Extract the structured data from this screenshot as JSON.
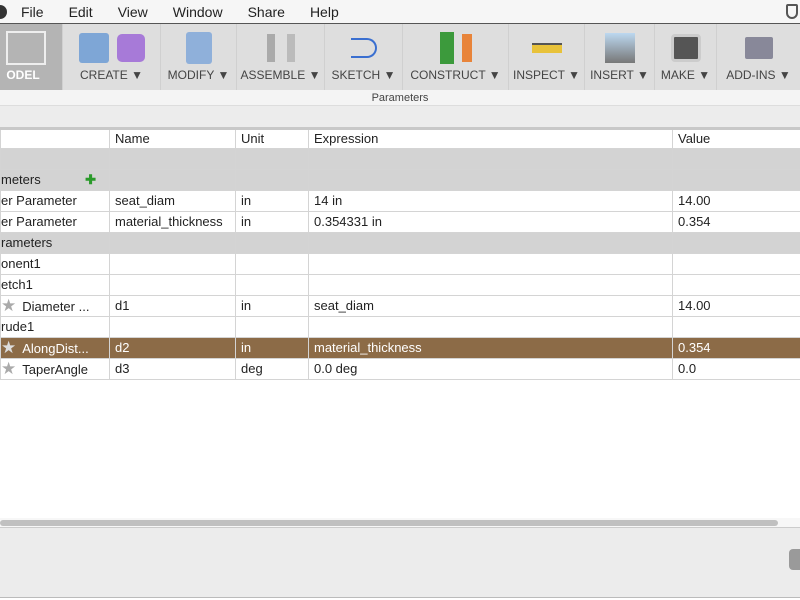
{
  "menu": [
    "File",
    "Edit",
    "View",
    "Window",
    "Share",
    "Help"
  ],
  "toolbar": {
    "groups": [
      "ODEL",
      "CREATE",
      "MODIFY",
      "ASSEMBLE",
      "SKETCH",
      "CONSTRUCT",
      "INSPECT",
      "INSERT",
      "MAKE",
      "ADD-INS"
    ]
  },
  "dialog_title": "Parameters",
  "table": {
    "headers": [
      "",
      "Name",
      "Unit",
      "Expression",
      "Value"
    ],
    "rows": [
      {
        "c0": "",
        "name": "",
        "unit": "",
        "expr": "",
        "value": ""
      },
      {
        "c0": "meters",
        "name": "",
        "unit": "",
        "expr": "",
        "value": ""
      },
      {
        "c0": "er Parameter",
        "name": "seat_diam",
        "unit": "in",
        "expr": "14 in",
        "value": "14.00"
      },
      {
        "c0": "er Parameter",
        "name": "material_thickness",
        "unit": "in",
        "expr": "0.354331 in",
        "value": "0.354"
      },
      {
        "c0": "rameters",
        "name": "",
        "unit": "",
        "expr": "",
        "value": ""
      },
      {
        "c0": "onent1",
        "name": "",
        "unit": "",
        "expr": "",
        "value": ""
      },
      {
        "c0": "etch1",
        "name": "",
        "unit": "",
        "expr": "",
        "value": ""
      },
      {
        "c0": "Diameter ...",
        "name": "d1",
        "unit": "in",
        "expr": "seat_diam",
        "value": "14.00"
      },
      {
        "c0": "rude1",
        "name": "",
        "unit": "",
        "expr": "",
        "value": ""
      },
      {
        "c0": "AlongDist...",
        "name": "d2",
        "unit": "in",
        "expr": "material_thickness",
        "value": "0.354"
      },
      {
        "c0": "TaperAngle",
        "name": "d3",
        "unit": "deg",
        "expr": "0.0 deg",
        "value": "0.0"
      }
    ]
  },
  "colors": {
    "selected_row": "#8c6b47",
    "group_row": "#d3d3d3"
  }
}
